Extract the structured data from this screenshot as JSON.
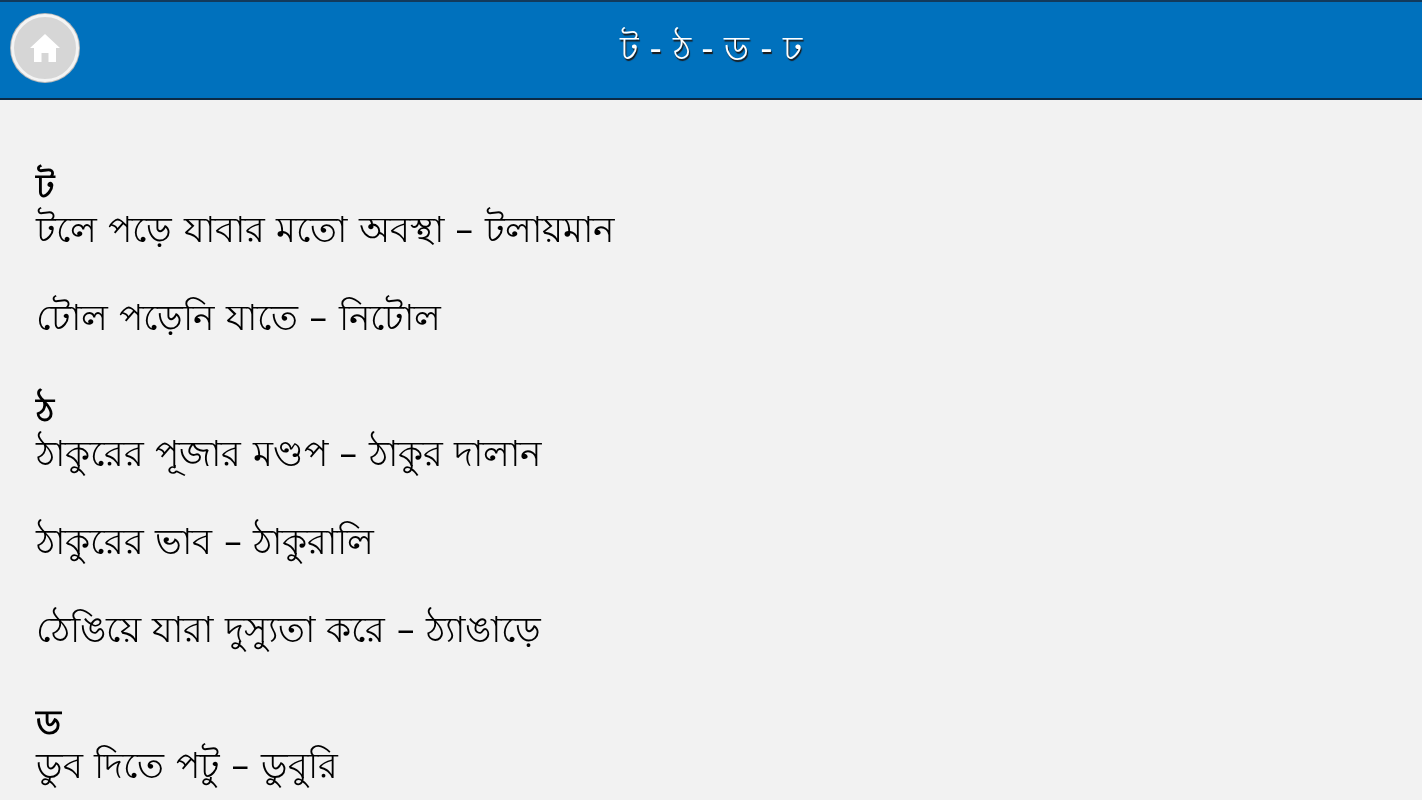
{
  "header": {
    "title": "ট - ঠ - ড - ঢ"
  },
  "sections": [
    {
      "letter": "ট",
      "entries": [
        "টলে পড়ে যাবার মতো অবস্থা – টলায়মান",
        "টোল পড়েনি যাতে – নিটোল"
      ]
    },
    {
      "letter": "ঠ",
      "entries": [
        "ঠাকুরের পূজার মণ্ডপ – ঠাকুর দালান",
        "ঠাকুরের ভাব – ঠাকুরালি",
        "ঠেঙিয়ে যারা দুস্যুতা করে – ঠ্যাঙাড়ে"
      ]
    },
    {
      "letter": "ড",
      "entries": [
        "ডুব দিতে পটু – ডুবুরি"
      ]
    }
  ]
}
